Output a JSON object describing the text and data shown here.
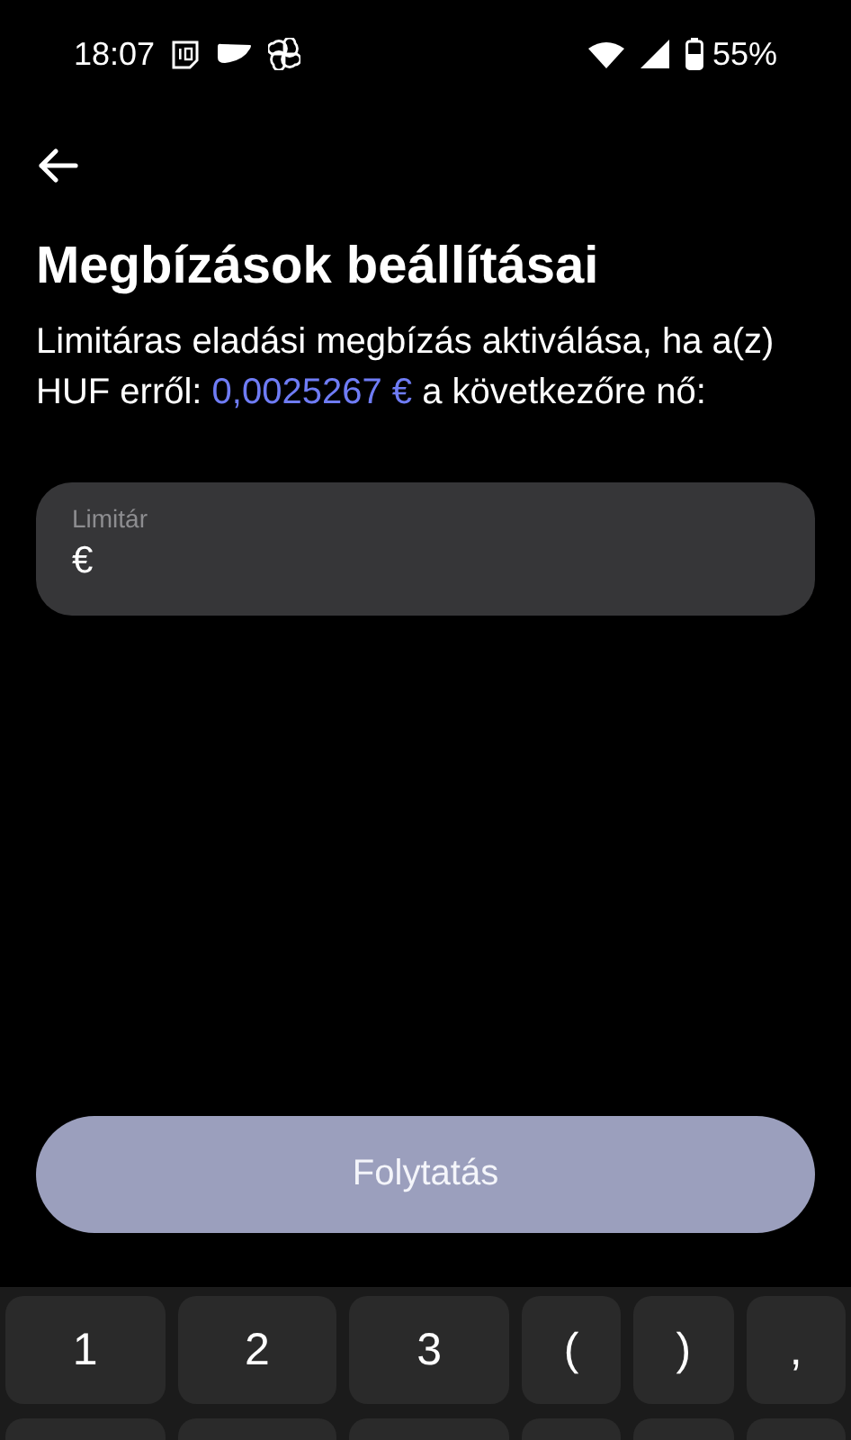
{
  "status_bar": {
    "time": "18:07",
    "battery": "55%"
  },
  "title": "Megbízások beállításai",
  "description": {
    "before": "Limitáras eladási megbízás aktiválása, ha a(z) HUF erről: ",
    "value": "0,0025267 €",
    "after": " a következőre nő:"
  },
  "field": {
    "label": "Limitár",
    "value": "€"
  },
  "continue_button": {
    "label": "Folytatás",
    "disabled": true
  },
  "keyboard": {
    "keys": [
      {
        "label": "1",
        "kind": "wide"
      },
      {
        "label": "2",
        "kind": "wide"
      },
      {
        "label": "3",
        "kind": "wide"
      },
      {
        "label": "(",
        "kind": "narrow"
      },
      {
        "label": ")",
        "kind": "narrow"
      },
      {
        "label": ",",
        "kind": "narrow"
      }
    ]
  }
}
